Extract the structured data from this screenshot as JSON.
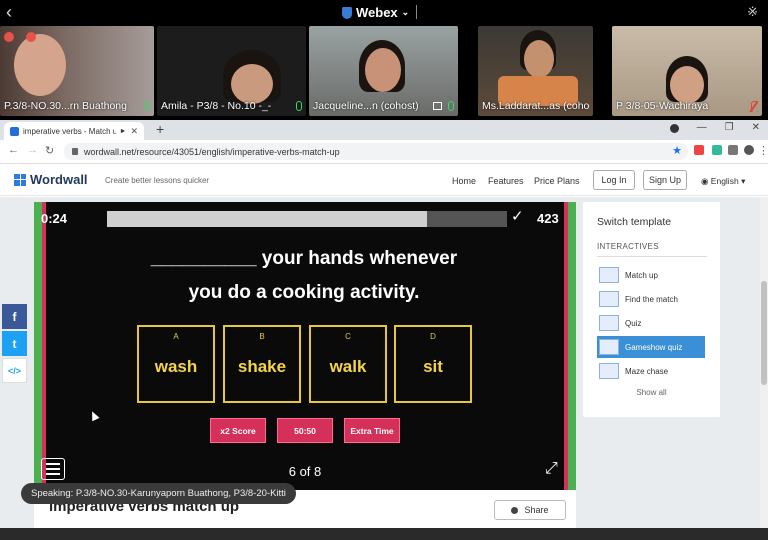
{
  "webex": {
    "title": "Webex",
    "participants": [
      {
        "name": "P.3/8-NO.30...rn Buathong",
        "mic": "on",
        "bg": "#6b5a55"
      },
      {
        "name": "Amila - P3/8 - No.10 -_-",
        "mic": "on",
        "bg": "#2a2a2a"
      },
      {
        "name": "Jacqueline...n (cohost)",
        "mic": "on",
        "bg": "#8a8f90"
      },
      {
        "name": "Ms.Laddarat...as (cohost)",
        "mic": "off",
        "bg": "#4a4640"
      },
      {
        "name": "P 3/8-05-Wachiraya",
        "mic": "off",
        "bg": "#b9a895"
      }
    ],
    "speaking": "Speaking: P.3/8-NO.30-Karunyaporn Buathong, P3/8-20-Kitti"
  },
  "browser": {
    "tab_title": "imperative verbs - Match up",
    "url": "wordwall.net/resource/43051/english/imperative-verbs-match-up"
  },
  "wordwall": {
    "logo": "Wordwall",
    "tagline": "Create better lessons quicker",
    "nav": [
      "Home",
      "Features",
      "Price Plans"
    ],
    "login": "Log In",
    "signup": "Sign Up",
    "language": "English",
    "social": [
      "f",
      "t",
      "</>"
    ],
    "activity_title": "imperative verbs match up",
    "share_label": "Share"
  },
  "game": {
    "timer": "0:24",
    "progress": 0.8,
    "score": "423",
    "question": "__________ your hands whenever\nyou do a cooking activity.",
    "options": [
      {
        "letter": "A",
        "text": "wash"
      },
      {
        "letter": "B",
        "text": "shake"
      },
      {
        "letter": "C",
        "text": "walk"
      },
      {
        "letter": "D",
        "text": "sit"
      }
    ],
    "powerups": [
      "x2 Score",
      "50:50",
      "Extra Time"
    ],
    "counter": "6 of 8"
  },
  "panel": {
    "title": "Switch template",
    "subtitle": "INTERACTIVES",
    "templates": [
      {
        "label": "Match up",
        "selected": false
      },
      {
        "label": "Find the match",
        "selected": false
      },
      {
        "label": "Quiz",
        "selected": false
      },
      {
        "label": "Gameshow quiz",
        "selected": true
      },
      {
        "label": "Maze chase",
        "selected": false
      }
    ],
    "show_all": "Show all"
  }
}
